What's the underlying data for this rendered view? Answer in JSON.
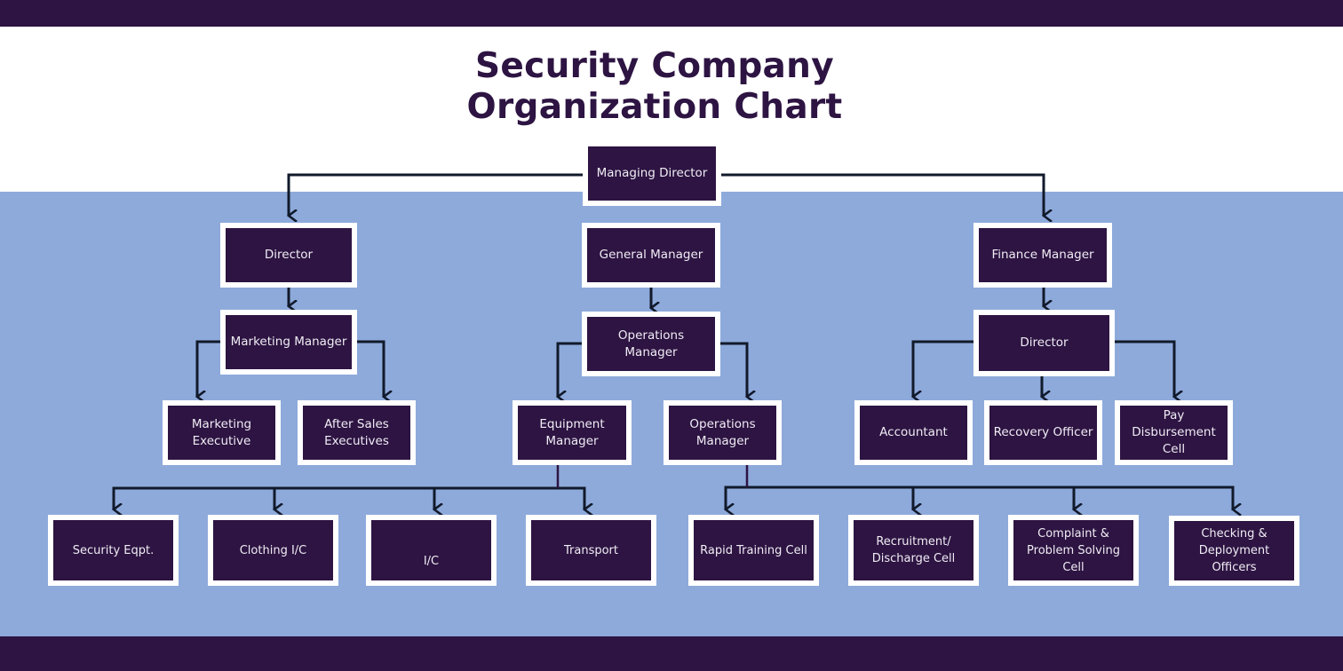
{
  "title": {
    "line1": "Security Company",
    "line2": "Organization Chart"
  },
  "colors": {
    "dark_purple": "#2d1442",
    "light_blue": "#8eaadb",
    "white": "#ffffff",
    "connector": "#111a2b"
  },
  "nodes": {
    "managing_director": "Managing Director",
    "director_left": "Director",
    "marketing_manager": "Marketing Manager",
    "marketing_executive": "Marketing Executive",
    "after_sales_executives": "After Sales Executives",
    "general_manager": "General Manager",
    "operations_manager_top": "Operations Manager",
    "equipment_manager": "Equipment Manager",
    "operations_manager_sub": "Operations Manager",
    "finance_manager": "Finance Manager",
    "director_right": "Director",
    "accountant": "Accountant",
    "recovery_officer": "Recovery Officer",
    "pay_disbursement_cell": "Pay Disbursement Cell",
    "security_eqpt": "Security Eqpt.",
    "clothing_ic": "Clothing I/C",
    "ic": "I/C",
    "transport": "Transport",
    "rapid_training_cell": "Rapid Training Cell",
    "recruitment_discharge_cell": "Recruitment/ Discharge Cell",
    "complaint_problem_solving_cell": "Complaint & Problem Solving Cell",
    "checking_deployment_officers": "Checking & Deployment Officers"
  },
  "hierarchy": [
    {
      "from": "managing_director",
      "to": [
        "director_left",
        "general_manager",
        "finance_manager"
      ]
    },
    {
      "from": "director_left",
      "to": [
        "marketing_manager"
      ]
    },
    {
      "from": "marketing_manager",
      "to": [
        "marketing_executive",
        "after_sales_executives"
      ]
    },
    {
      "from": "general_manager",
      "to": [
        "operations_manager_top"
      ]
    },
    {
      "from": "operations_manager_top",
      "to": [
        "equipment_manager",
        "operations_manager_sub"
      ]
    },
    {
      "from": "equipment_manager",
      "to": [
        "security_eqpt",
        "clothing_ic",
        "ic",
        "transport"
      ]
    },
    {
      "from": "operations_manager_sub",
      "to": [
        "rapid_training_cell",
        "recruitment_discharge_cell",
        "complaint_problem_solving_cell",
        "checking_deployment_officers"
      ]
    },
    {
      "from": "finance_manager",
      "to": [
        "director_right"
      ]
    },
    {
      "from": "director_right",
      "to": [
        "accountant",
        "recovery_officer",
        "pay_disbursement_cell"
      ]
    }
  ]
}
